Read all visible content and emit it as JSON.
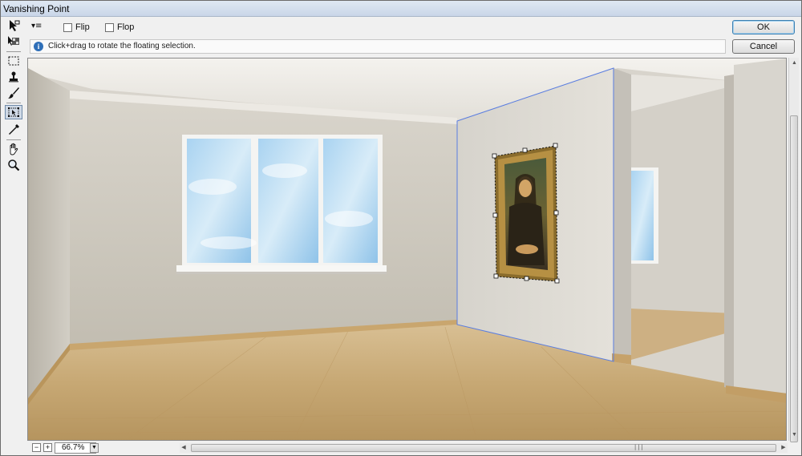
{
  "window": {
    "title": "Vanishing Point"
  },
  "tools": [
    {
      "name": "edit-plane-tool"
    },
    {
      "name": "create-plane-tool"
    },
    {
      "name": "marquee-tool"
    },
    {
      "name": "stamp-tool"
    },
    {
      "name": "brush-tool"
    },
    {
      "name": "transform-tool",
      "active": true
    },
    {
      "name": "eyedropper-tool"
    },
    {
      "name": "hand-tool"
    },
    {
      "name": "zoom-tool"
    }
  ],
  "options": {
    "menu_glyph": "▾≡",
    "flip_label": "Flip",
    "flop_label": "Flop"
  },
  "info": {
    "message": "Click+drag to rotate the floating selection."
  },
  "buttons": {
    "ok": "OK",
    "cancel": "Cancel"
  },
  "status": {
    "zoom": "66.7%",
    "zoom_out": "−",
    "zoom_in": "+"
  },
  "colors": {
    "accent": "#3c7fb1",
    "plane_grid": "#5a7de0"
  }
}
